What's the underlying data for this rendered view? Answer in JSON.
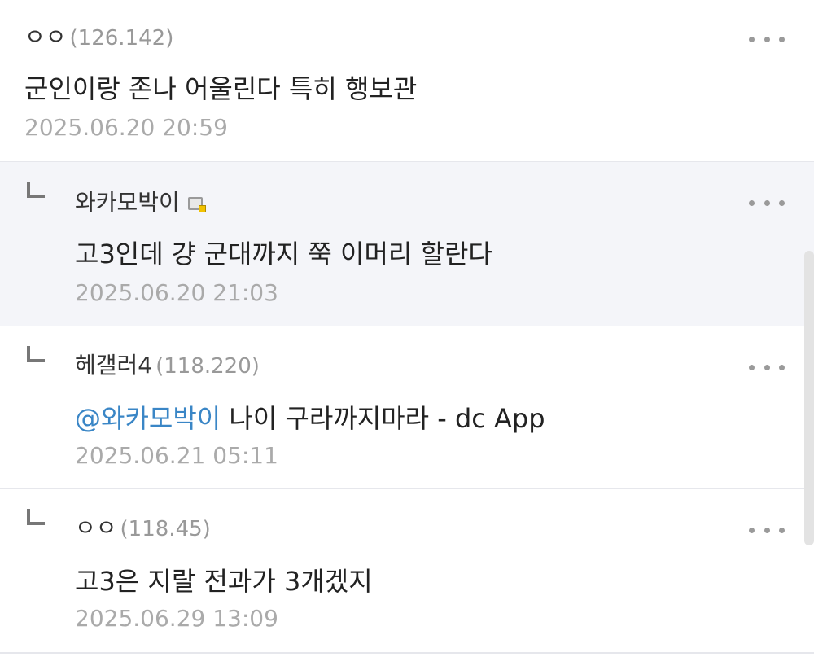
{
  "comments": [
    {
      "nick": "ㅇㅇ",
      "ip": "(126.142)",
      "text": "군인이랑 존나 어울린다 특히 행보관",
      "date": "2025.06.20 20:59"
    },
    {
      "nick": "와카모박이",
      "text": "고3인데 걍 군대까지 쭉 이머리 할란다",
      "date": "2025.06.20 21:03"
    },
    {
      "nick": "헤갤러4",
      "ip": "(118.220)",
      "mention": "@와카모박이",
      "text": " 나이 구라까지마라 - dc App",
      "date": "2025.06.21 05:11"
    },
    {
      "nick": "ㅇㅇ",
      "ip": "(118.45)",
      "text": "고3은 지랄 전과가 3개겠지",
      "date": "2025.06.29 13:09"
    }
  ],
  "icons": {
    "reply": "reply-arrow-icon",
    "more": "more-dots-icon",
    "gallog": "gallog-icon"
  },
  "colors": {
    "mention": "#3a86c6",
    "reply_bg": "#f4f5f9"
  }
}
